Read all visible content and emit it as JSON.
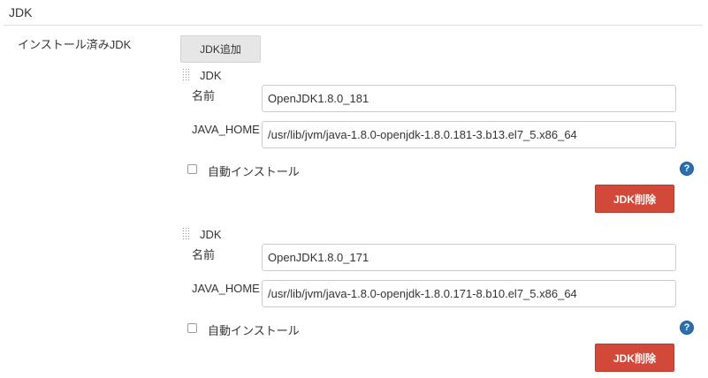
{
  "section": {
    "title": "JDK"
  },
  "installations": {
    "label": "インストール済みJDK",
    "add_button": "JDK追加"
  },
  "jdks": [
    {
      "title": "JDK",
      "name_label": "名前",
      "name_value": "OpenJDK1.8.0_181",
      "home_label": "JAVA_HOME",
      "home_value": "/usr/lib/jvm/java-1.8.0-openjdk-1.8.0.181-3.b13.el7_5.x86_64",
      "auto_install_label": "自動インストール",
      "auto_install_checked": false,
      "delete_button": "JDK削除"
    },
    {
      "title": "JDK",
      "name_label": "名前",
      "name_value": "OpenJDK1.8.0_171",
      "home_label": "JAVA_HOME",
      "home_value": "/usr/lib/jvm/java-1.8.0-openjdk-1.8.0.171-8.b10.el7_5.x86_64",
      "auto_install_label": "自動インストール",
      "auto_install_checked": false,
      "delete_button": "JDK削除"
    }
  ],
  "help_icon_glyph": "?",
  "colors": {
    "delete_button": "#d24939",
    "help_icon": "#2a6fb0",
    "add_button": "#e6e6e6"
  }
}
